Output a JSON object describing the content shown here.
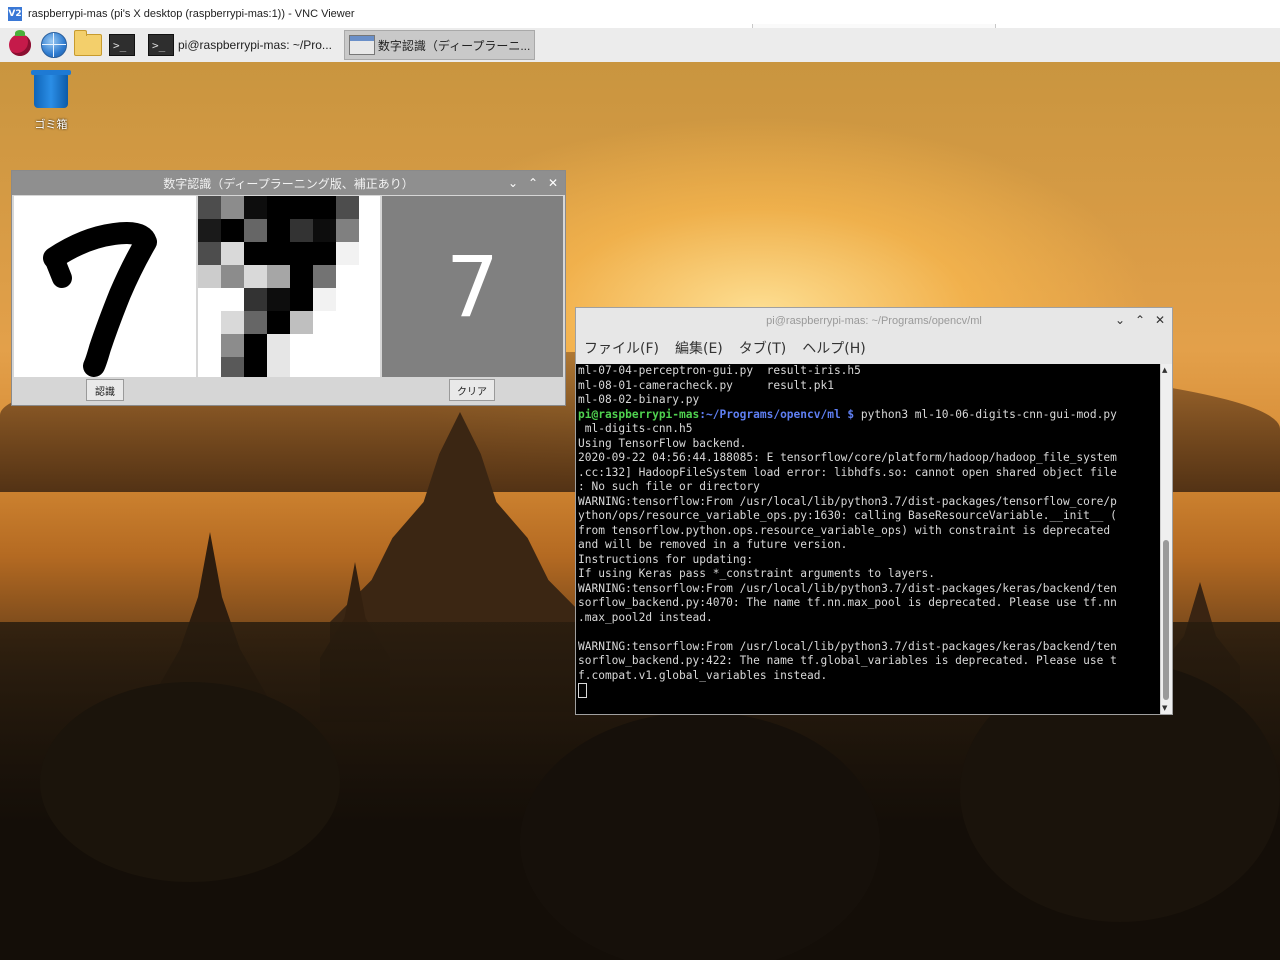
{
  "vnc": {
    "title": "raspberrypi-mas (pi's X desktop (raspberrypi-mas:1)) - VNC Viewer",
    "icon": "vnc-icon"
  },
  "panel": {
    "launchers": [
      "raspberry-menu-icon",
      "web-browser-icon",
      "file-manager-icon",
      "terminal-icon"
    ],
    "tasks": [
      {
        "label": "pi@raspberrypi-mas: ~/Pro...",
        "icon": "terminal-icon",
        "active": false
      },
      {
        "label": "数字認識（ディープラーニ...",
        "icon": "window-icon",
        "active": true
      }
    ]
  },
  "desktop": {
    "trash_label": "ゴミ箱"
  },
  "digit_window": {
    "title": "数字認識（ディープラーニング版、補正あり）",
    "controls": [
      "⌄",
      "⌃",
      "✕"
    ],
    "result": "7",
    "recognize_label": "認識",
    "clear_label": "クリア",
    "pixel_grid": [
      [
        0.3,
        0.55,
        0.05,
        0.0,
        0.0,
        0.0,
        0.3,
        1.0
      ],
      [
        0.1,
        0.0,
        0.4,
        0.0,
        0.2,
        0.05,
        0.5,
        1.0
      ],
      [
        0.3,
        0.85,
        0.0,
        0.0,
        0.0,
        0.0,
        0.95,
        1.0
      ],
      [
        0.8,
        0.55,
        0.85,
        0.65,
        0.0,
        0.45,
        1.0,
        1.0
      ],
      [
        1.0,
        1.0,
        0.2,
        0.05,
        0.0,
        0.95,
        1.0,
        1.0
      ],
      [
        1.0,
        0.85,
        0.4,
        0.0,
        0.75,
        1.0,
        1.0,
        1.0
      ],
      [
        1.0,
        0.55,
        0.0,
        0.9,
        1.0,
        1.0,
        1.0,
        1.0
      ],
      [
        1.0,
        0.35,
        0.0,
        0.9,
        1.0,
        1.0,
        1.0,
        1.0
      ]
    ]
  },
  "terminal": {
    "title": "pi@raspberrypi-mas: ~/Programs/opencv/ml",
    "controls": [
      "⌄",
      "⌃",
      "✕"
    ],
    "menu": [
      "ファイル(F)",
      "編集(E)",
      "タブ(T)",
      "ヘルプ(H)"
    ],
    "lines_before": [
      "ml-07-04-perceptron-gui.py  result-iris.h5",
      "ml-08-01-cameracheck.py     result.pk1",
      "ml-08-02-binary.py"
    ],
    "prompt_user": "pi@raspberrypi-mas",
    "prompt_path": ":~/Programs/opencv/ml $",
    "command": " python3 ml-10-06-digits-cnn-gui-mod.py",
    "lines_after": [
      " ml-digits-cnn.h5",
      "Using TensorFlow backend.",
      "2020-09-22 04:56:44.188085: E tensorflow/core/platform/hadoop/hadoop_file_system",
      ".cc:132] HadoopFileSystem load error: libhdfs.so: cannot open shared object file",
      ": No such file or directory",
      "WARNING:tensorflow:From /usr/local/lib/python3.7/dist-packages/tensorflow_core/p",
      "ython/ops/resource_variable_ops.py:1630: calling BaseResourceVariable.__init__ (",
      "from tensorflow.python.ops.resource_variable_ops) with constraint is deprecated",
      "and will be removed in a future version.",
      "Instructions for updating:",
      "If using Keras pass *_constraint arguments to layers.",
      "WARNING:tensorflow:From /usr/local/lib/python3.7/dist-packages/keras/backend/ten",
      "sorflow_backend.py:4070: The name tf.nn.max_pool is deprecated. Please use tf.nn",
      ".max_pool2d instead.",
      "",
      "WARNING:tensorflow:From /usr/local/lib/python3.7/dist-packages/keras/backend/ten",
      "sorflow_backend.py:422: The name tf.global_variables is deprecated. Please use t",
      "f.compat.v1.global_variables instead.",
      ""
    ],
    "colors": {
      "user": "#4fd14f",
      "path": "#5f7ff2",
      "text": "#d8d8d8",
      "bg": "#000000"
    }
  }
}
